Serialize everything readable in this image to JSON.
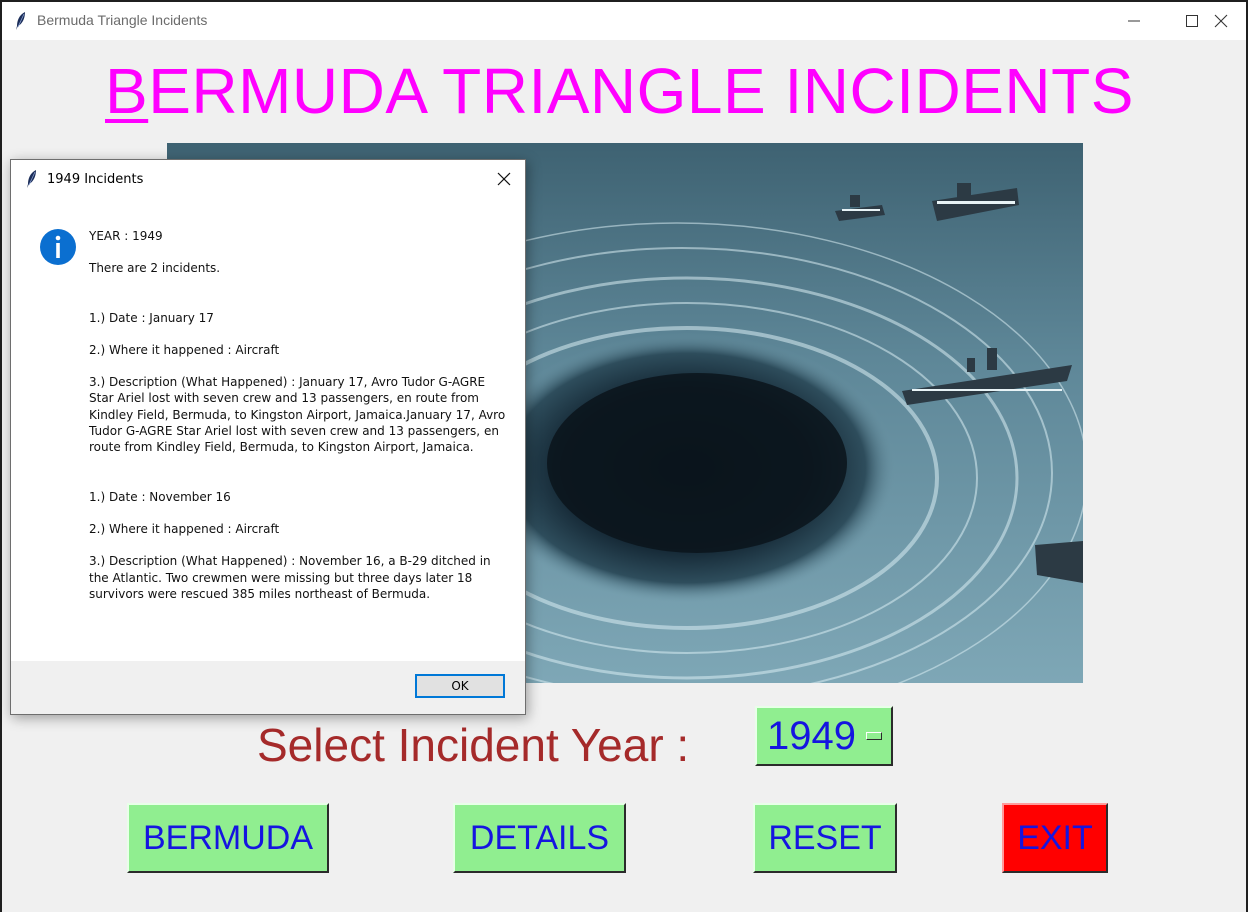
{
  "window": {
    "title": "Bermuda Triangle Incidents",
    "icon": "feather-icon"
  },
  "heading": {
    "first_letter": "B",
    "rest": "ERMUDA TRIANGLE INCIDENTS",
    "color": "#ff00ff"
  },
  "image": {
    "description_icon": "whirlpool-ships-image"
  },
  "selector": {
    "label": "Select Incident Year  :",
    "value": "1949",
    "label_color": "#a52a2a"
  },
  "buttons": {
    "bermuda": "BERMUDA",
    "details": "DETAILS",
    "reset": "RESET",
    "exit": "EXIT"
  },
  "colors": {
    "button_green": "#90ee90",
    "exit_red": "#ff0000",
    "button_text": "#1515e0"
  },
  "dialog": {
    "title": "1949 Incidents",
    "icon": "info-icon",
    "year_line": "YEAR  :  1949",
    "count_line": "There are  2  incidents.",
    "incidents": [
      {
        "date": "1.)  Date  :  January 17",
        "where": "2.)  Where it happened  :  Aircraft",
        "description": "3.)  Description (What Happened)  :  January 17, Avro Tudor G-AGRE Star Ariel lost with seven crew and 13 passengers, en route from Kindley Field, Bermuda, to Kingston Airport, Jamaica.January 17, Avro Tudor G-AGRE Star Ariel lost with seven crew and 13 passengers, en route from Kindley Field, Bermuda, to Kingston Airport, Jamaica."
      },
      {
        "date": "1.)  Date  :  November 16",
        "where": "2.)  Where it happened  :  Aircraft",
        "description": "3.)  Description (What Happened)  :  November 16, a B-29 ditched in the Atlantic. Two crewmen were missing but three days later 18 survivors were rescued 385 miles northeast of Bermuda."
      }
    ],
    "ok_label": "OK"
  }
}
